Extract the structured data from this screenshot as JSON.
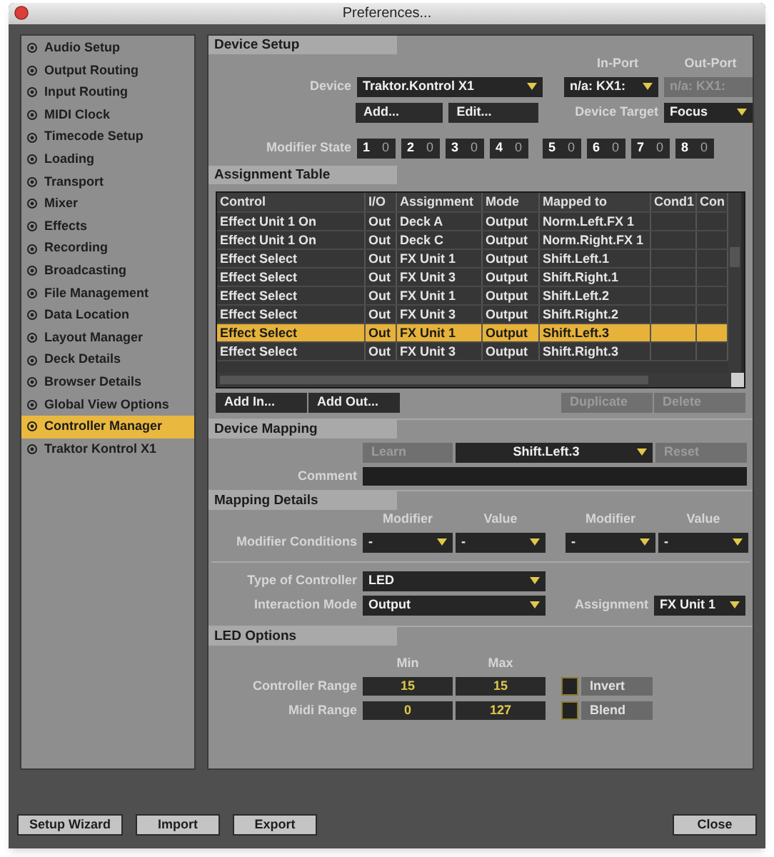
{
  "window": {
    "title": "Preferences..."
  },
  "sidebar": {
    "items": [
      {
        "label": "Audio Setup",
        "selected": false
      },
      {
        "label": "Output Routing",
        "selected": false
      },
      {
        "label": "Input Routing",
        "selected": false
      },
      {
        "label": "MIDI Clock",
        "selected": false
      },
      {
        "label": "Timecode Setup",
        "selected": false
      },
      {
        "label": "Loading",
        "selected": false
      },
      {
        "label": "Transport",
        "selected": false
      },
      {
        "label": "Mixer",
        "selected": false
      },
      {
        "label": "Effects",
        "selected": false
      },
      {
        "label": "Recording",
        "selected": false
      },
      {
        "label": "Broadcasting",
        "selected": false
      },
      {
        "label": "File Management",
        "selected": false
      },
      {
        "label": "Data Location",
        "selected": false
      },
      {
        "label": "Layout Manager",
        "selected": false
      },
      {
        "label": "Deck Details",
        "selected": false
      },
      {
        "label": "Browser Details",
        "selected": false
      },
      {
        "label": "Global View Options",
        "selected": false
      },
      {
        "label": "Controller Manager",
        "selected": true
      },
      {
        "label": "Traktor Kontrol X1",
        "selected": false
      }
    ]
  },
  "device_setup": {
    "title": "Device Setup",
    "in_port_label": "In-Port",
    "out_port_label": "Out-Port",
    "device_label": "Device",
    "device": "Traktor.Kontrol X1",
    "in_port": {
      "value": "n/a: KX1:",
      "disabled": false
    },
    "out_port": {
      "value": "n/a: KX1:",
      "disabled": true
    },
    "add_button": "Add...",
    "edit_button": "Edit...",
    "device_target_label": "Device Target",
    "device_target": "Focus",
    "modifier_state_label": "Modifier State",
    "modifier_state": [
      {
        "number": "1",
        "value": "0"
      },
      {
        "number": "2",
        "value": "0"
      },
      {
        "number": "3",
        "value": "0"
      },
      {
        "number": "4",
        "value": "0"
      },
      {
        "number": "5",
        "value": "0"
      },
      {
        "number": "6",
        "value": "0"
      },
      {
        "number": "7",
        "value": "0"
      },
      {
        "number": "8",
        "value": "0"
      }
    ]
  },
  "assignment_table": {
    "title": "Assignment Table",
    "columns": [
      "Control",
      "I/O",
      "Assignment",
      "Mode",
      "Mapped to",
      "Cond1",
      "Con"
    ],
    "rows": [
      {
        "control": "Effect Unit 1 On",
        "io": "Out",
        "assignment": "Deck A",
        "mode": "Output",
        "mapped_to": "Norm.Left.FX 1",
        "selected": false
      },
      {
        "control": "Effect Unit 1 On",
        "io": "Out",
        "assignment": "Deck C",
        "mode": "Output",
        "mapped_to": "Norm.Right.FX 1",
        "selected": false
      },
      {
        "control": "Effect Select",
        "io": "Out",
        "assignment": "FX Unit 1",
        "mode": "Output",
        "mapped_to": "Shift.Left.1",
        "selected": false
      },
      {
        "control": "Effect Select",
        "io": "Out",
        "assignment": "FX Unit 3",
        "mode": "Output",
        "mapped_to": "Shift.Right.1",
        "selected": false
      },
      {
        "control": "Effect Select",
        "io": "Out",
        "assignment": "FX Unit 1",
        "mode": "Output",
        "mapped_to": "Shift.Left.2",
        "selected": false
      },
      {
        "control": "Effect Select",
        "io": "Out",
        "assignment": "FX Unit 3",
        "mode": "Output",
        "mapped_to": "Shift.Right.2",
        "selected": false
      },
      {
        "control": "Effect Select",
        "io": "Out",
        "assignment": "FX Unit 1",
        "mode": "Output",
        "mapped_to": "Shift.Left.3",
        "selected": true
      },
      {
        "control": "Effect Select",
        "io": "Out",
        "assignment": "FX Unit 3",
        "mode": "Output",
        "mapped_to": "Shift.Right.3",
        "selected": false
      }
    ],
    "buttons": [
      {
        "label": "Add In...",
        "disabled": false
      },
      {
        "label": "Add Out...",
        "disabled": false
      },
      {
        "label": "Duplicate",
        "disabled": true
      },
      {
        "label": "Delete",
        "disabled": true
      }
    ]
  },
  "device_mapping": {
    "title": "Device Mapping",
    "learn_button": {
      "label": "Learn",
      "disabled": true
    },
    "mapping": "Shift.Left.3",
    "reset_button": {
      "label": "Reset",
      "disabled": true
    },
    "comment_label": "Comment"
  },
  "mapping_details": {
    "title": "Mapping Details",
    "modifier_conditions_label": "Modifier Conditions",
    "conditions": [
      {
        "modifier_label": "Modifier",
        "modifier": "-",
        "value_label": "Value",
        "value": "-"
      },
      {
        "modifier_label": "Modifier",
        "modifier": "-",
        "value_label": "Value",
        "value": "-"
      }
    ],
    "type_label": "Type of Controller",
    "type": "LED",
    "interaction_label": "Interaction Mode",
    "interaction": "Output",
    "assignment_label": "Assignment",
    "assignment": "FX Unit 1"
  },
  "led_options": {
    "title": "LED Options",
    "min_label": "Min",
    "max_label": "Max",
    "ranges": [
      {
        "label": "Controller Range",
        "min": "15",
        "max": "15",
        "option": "Invert",
        "checked": false
      },
      {
        "label": "Midi Range",
        "min": "0",
        "max": "127",
        "option": "Blend",
        "checked": false
      }
    ]
  },
  "footer": {
    "buttons": [
      "Setup Wizard",
      "Import",
      "Export",
      "Close"
    ]
  }
}
